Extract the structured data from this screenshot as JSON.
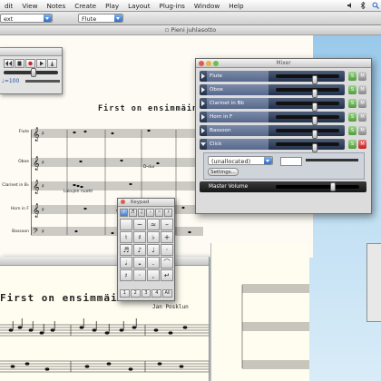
{
  "menubar": {
    "items": [
      "dit",
      "View",
      "Notes",
      "Create",
      "Play",
      "Layout",
      "Plug-ins",
      "Window",
      "Help"
    ]
  },
  "toolbar": {
    "text_style": "ext",
    "instrument": "Flute"
  },
  "document": {
    "title": "Pieni juhlasotto"
  },
  "transport": {
    "tempo": "♩=100"
  },
  "score": {
    "title": "First on ensimmäinen",
    "instruments": [
      "Flute",
      "Oboe",
      "Clarinet in B♭",
      "Horn in F",
      "Bassoon"
    ],
    "composer": "Jan Posklun",
    "annotations": [
      "D-dur",
      "Lukujen nuotit",
      "lyhyt"
    ]
  },
  "mixer": {
    "title": "Mixer",
    "channels": [
      {
        "name": "Flute",
        "level": 0.62
      },
      {
        "name": "Oboe",
        "level": 0.62
      },
      {
        "name": "Clarinet in Bb",
        "level": 0.62
      },
      {
        "name": "Horn in F",
        "level": 0.62
      },
      {
        "name": "Bassoon",
        "level": 0.62
      },
      {
        "name": "Click",
        "level": 0.62
      }
    ],
    "click_sound": "(unallocated)",
    "settings_button": "Settings...",
    "master_label": "Master Volume",
    "solo_label": "S",
    "mute_label": "M"
  },
  "keypad": {
    "title": "Keypad",
    "bottom": [
      "1",
      "2",
      "3",
      "4",
      "All"
    ]
  },
  "colors": {
    "desktop": "#b9dbf2",
    "mixer_strip": "#4d5d78",
    "solo": "#4f9c3a",
    "mute_active": "#d03030",
    "transport_record": "#cc2222"
  }
}
